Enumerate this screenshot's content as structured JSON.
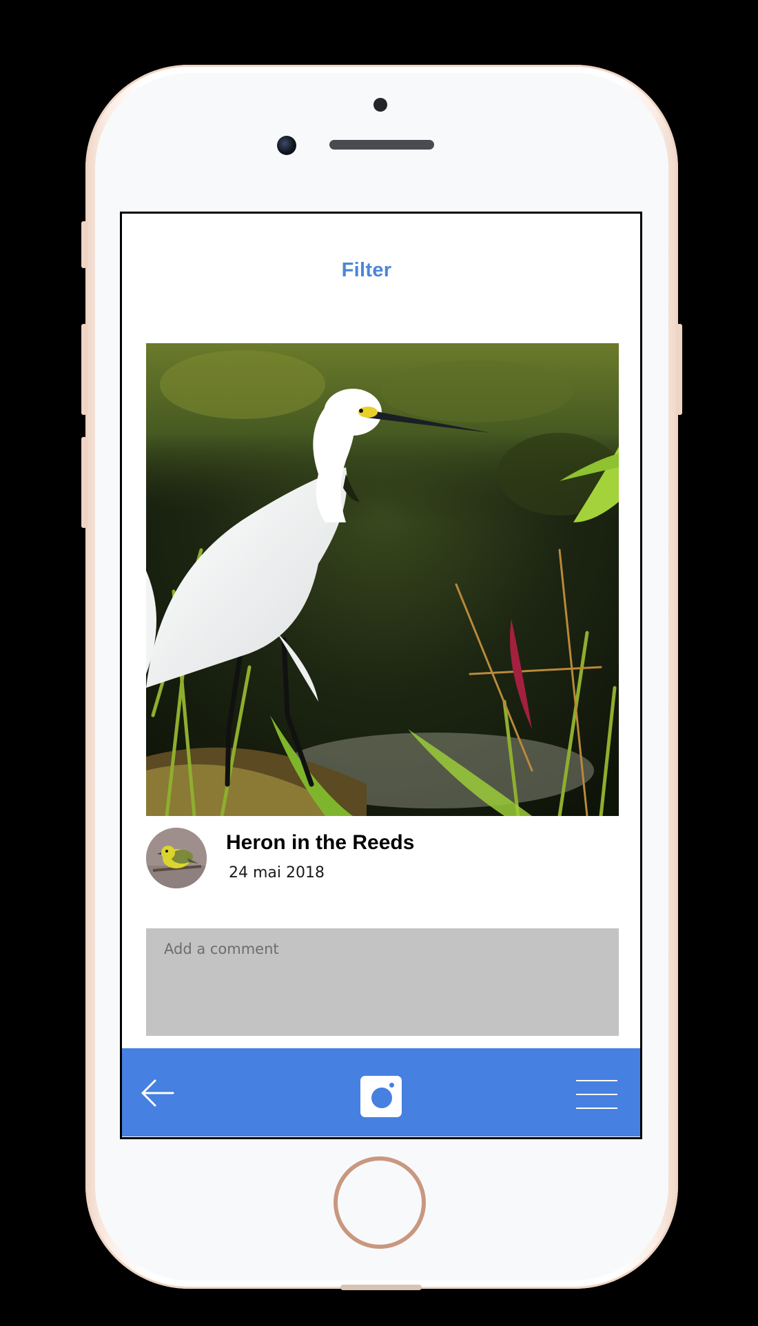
{
  "header": {
    "title": "Filter"
  },
  "post": {
    "photo_subject": "egret-in-reeds",
    "avatar_subject": "yellow-songbird",
    "title": "Heron in the Reeds",
    "date": "24 mai 2018"
  },
  "comment": {
    "placeholder": "Add a comment",
    "value": ""
  },
  "bottom_bar": {
    "back_icon": "arrow-left-icon",
    "camera_icon": "camera-icon",
    "menu_icon": "hamburger-menu-icon"
  },
  "colors": {
    "accent": "#4680e1",
    "title_blue": "#4a86d8",
    "comment_bg": "#c3c3c3",
    "screen_bg": "#ffffff",
    "phone_trim": "#f0d5c4"
  }
}
